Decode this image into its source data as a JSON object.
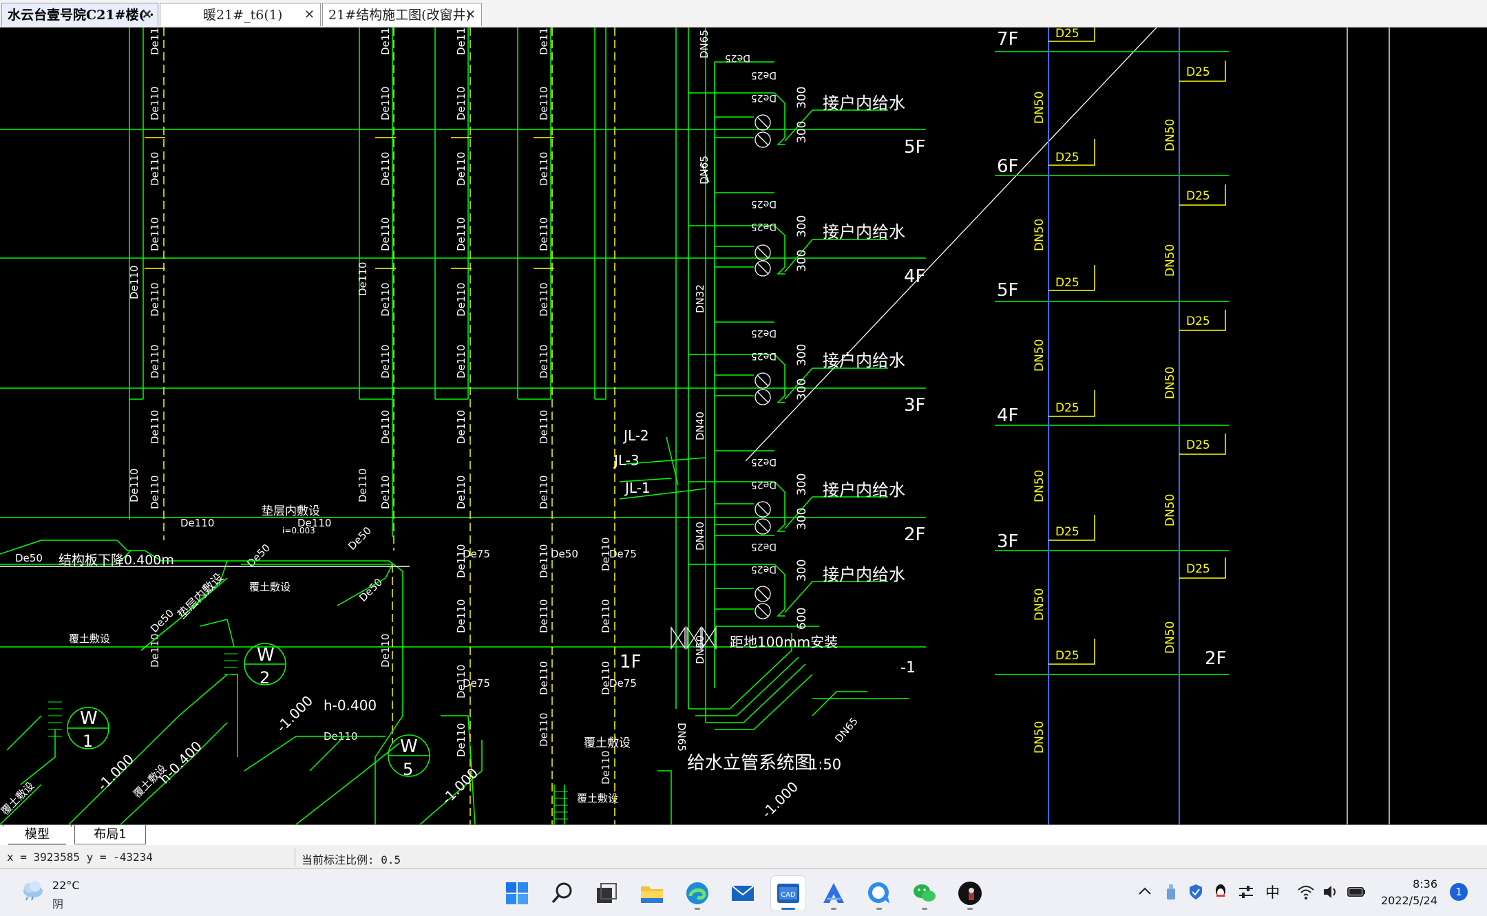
{
  "tabs": [
    {
      "label": "水云台壹号院C21#楼(··",
      "active": true
    },
    {
      "label": "暖21#_t6(1)",
      "active": false
    },
    {
      "label": "21#结构施工图(改窗井)",
      "active": false
    }
  ],
  "drawing": {
    "colors": {
      "bg": "#000000",
      "green": "#00ff00",
      "yellow": "#ffff00",
      "white": "#ffffff",
      "blue": "#3a6dff"
    },
    "left_pipe_labels": [
      "De110",
      "De75",
      "De50"
    ],
    "left_labels": {
      "cushion": "垫层内敷设",
      "slab_drop": "结构板下降0.400m",
      "cover1": "覆土敷设",
      "cover2": "覆土敷设",
      "cover3": "覆土敷设",
      "cover4": "覆土敷设",
      "cover5": "覆土敷设",
      "cover6": "覆土敷设",
      "cushion2": "垫层内敷设",
      "h1": "h-0.400",
      "h2": "h-0.400",
      "elev1": "-1.000",
      "elev2": "-1.000",
      "elev3": "-1.000",
      "elev4": "-1.000",
      "elev5": "-1.000",
      "small_level": "i=0.003",
      "w1_letter": "W",
      "w1_num": "1",
      "w2_letter": "W",
      "w2_num": "2",
      "w5_letter": "W",
      "w5_num": "5"
    },
    "riser": {
      "floors": [
        "5F",
        "4F",
        "3F",
        "2F",
        "1F",
        "-1"
      ],
      "jl": [
        "JL-2",
        "JL-3",
        "JL-1"
      ],
      "pipe_labels": [
        "DN65",
        "DN32",
        "DN40",
        "DN40",
        "DN50",
        "DN65",
        "DN65"
      ],
      "branch_label": "De25",
      "dim_300": "300",
      "dim_600": "600",
      "household": "接户内给水",
      "bottom_note": "距地100mm安装",
      "cover_note": "覆土敷设",
      "title": "给水立管系统图",
      "scale": "1:50"
    },
    "right_system": {
      "floors_left": [
        "7F",
        "6F",
        "5F",
        "4F",
        "3F"
      ],
      "floor_right": "2F",
      "d25": "D25",
      "dn50": "DN50"
    }
  },
  "layout_tabs": [
    {
      "label": "模型"
    },
    {
      "label": "布局1"
    }
  ],
  "status": {
    "coords": "x = 3923585 y = -43234",
    "scale": "当前标注比例: 0.5"
  },
  "taskbar": {
    "weather_temp": "22°C",
    "weather_cond": "阴",
    "ime": "中",
    "time": "8:36",
    "date": "2022/5/24",
    "notifications": "1",
    "icons": [
      "start-icon",
      "search-icon",
      "task-view-icon",
      "file-explorer-icon",
      "edge-icon",
      "mail-icon",
      "cad-icon",
      "app-a-icon",
      "app-chat-icon",
      "wechat-icon",
      "avatar-app-icon"
    ]
  }
}
